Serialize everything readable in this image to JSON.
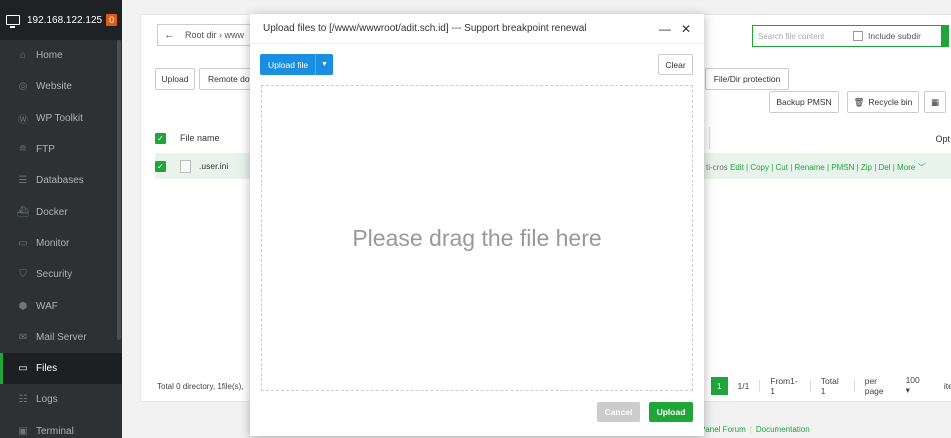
{
  "sidebar": {
    "server_ip": "192.168.122.125",
    "badge": "0",
    "items": [
      {
        "label": "Home",
        "icon": "home-icon",
        "glyph": "⌂"
      },
      {
        "label": "Website",
        "icon": "globe-icon",
        "glyph": "◎"
      },
      {
        "label": "WP Toolkit",
        "icon": "wordpress-icon",
        "glyph": "Ⓦ"
      },
      {
        "label": "FTP",
        "icon": "ftp-icon",
        "glyph": "≘"
      },
      {
        "label": "Databases",
        "icon": "database-icon",
        "glyph": "☰"
      },
      {
        "label": "Docker",
        "icon": "docker-icon",
        "glyph": "⛴"
      },
      {
        "label": "Monitor",
        "icon": "monitor-icon",
        "glyph": "▭"
      },
      {
        "label": "Security",
        "icon": "shield-icon",
        "glyph": "⛉"
      },
      {
        "label": "WAF",
        "icon": "waf-shield-icon",
        "glyph": "⬢"
      },
      {
        "label": "Mail Server",
        "icon": "mail-icon",
        "glyph": "✉"
      },
      {
        "label": "Files",
        "icon": "folder-icon",
        "glyph": "▭"
      },
      {
        "label": "Logs",
        "icon": "logs-icon",
        "glyph": "☷"
      },
      {
        "label": "Terminal",
        "icon": "terminal-icon",
        "glyph": "▣"
      }
    ],
    "active": "Files"
  },
  "files": {
    "path_back": "←",
    "path_text": "Root dir  ›  www",
    "search_placeholder": "Search file content",
    "include_subdir": "Include subdir",
    "toolbar": {
      "upload": "Upload",
      "remote_download": "Remote dow",
      "file_dir_protection": "File/Dir protection",
      "backup_pmsn": "Backup PMSN",
      "recycle_bin": "Recycle bin"
    },
    "table": {
      "col_name": "File name",
      "col_ops": "Opt",
      "rows": [
        {
          "name": ".user.ini",
          "ops_prefix": "ti-cros",
          "ops": "Edit | Copy | Cut | Rename | PMSN | Zip | Del | More"
        }
      ]
    },
    "total": "Total 0 directory, 1file(s),",
    "pager": {
      "current": "1",
      "pages": "1/1",
      "range": "From1-1",
      "total": "Total 1",
      "per_page_label": "per page",
      "per_page": "100",
      "items": "item"
    },
    "footer": {
      "forum": "Panel Forum",
      "docs": "Documentation"
    }
  },
  "modal": {
    "title": "Upload files to [/www/wwwroot/adit.sch.id] --- Support breakpoint renewal",
    "upload_file": "Upload file",
    "clear": "Clear",
    "drop_message": "Please drag the file here",
    "cancel": "Cancel",
    "upload": "Upload"
  },
  "colors": {
    "brand_green": "#20a53a",
    "upload_blue": "#1a8ee0",
    "sidebar_bg": "#2d3133",
    "badge_orange": "#e05d0e"
  }
}
